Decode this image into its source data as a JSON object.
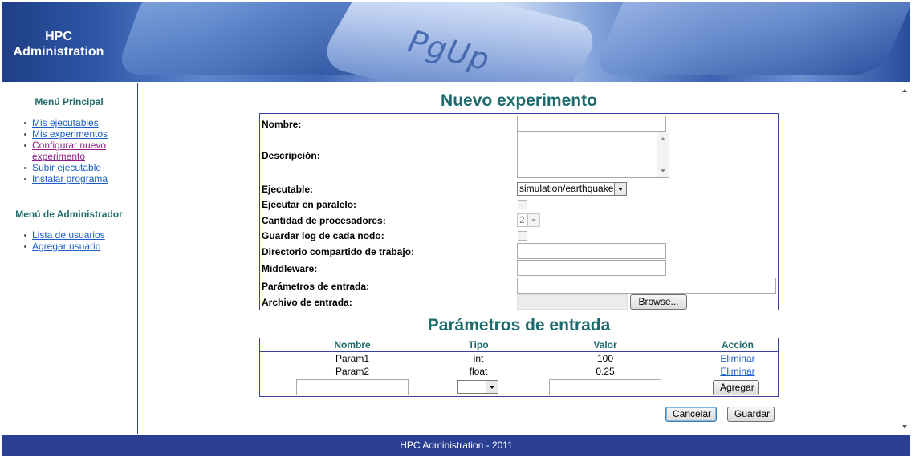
{
  "header": {
    "logo_line1": "HPC",
    "logo_line2": "Administration",
    "banner_key_text": "PgUp"
  },
  "sidebar": {
    "main_menu_title": "Menú Principal",
    "main_menu_items": [
      {
        "label": "Mis ejecutables"
      },
      {
        "label": "Mis experimentos"
      },
      {
        "label": "Configurar nuevo experimento"
      },
      {
        "label": "Subir ejecutable"
      },
      {
        "label": "Instalar programa"
      }
    ],
    "admin_menu_title": "Menú de Administrador",
    "admin_menu_items": [
      {
        "label": "Lista de usuarios"
      },
      {
        "label": "Agregar usuario"
      }
    ]
  },
  "form": {
    "title": "Nuevo experimento",
    "nombre_label": "Nombre:",
    "nombre_value": "",
    "descripcion_label": "Descripción:",
    "descripcion_value": "",
    "ejecutable_label": "Ejecutable:",
    "ejecutable_value": "simulation/earthquake",
    "paralelo_label": "Ejecutar en paralelo:",
    "paralelo_checked": false,
    "procesadores_label": "Cantidad de procesadores:",
    "procesadores_value": "2",
    "log_label": "Guardar log de cada nodo:",
    "log_checked": false,
    "directorio_label": "Directorio compartido de trabajo:",
    "directorio_value": "",
    "middleware_label": "Middleware:",
    "middleware_value": "",
    "parametros_label": "Parámetros de entrada:",
    "parametros_value": "",
    "archivo_label": "Archivo de entrada:",
    "browse_label": "Browse..."
  },
  "params": {
    "title": "Parámetros de entrada",
    "headers": {
      "nombre": "Nombre",
      "tipo": "Tipo",
      "valor": "Valor",
      "accion": "Acción"
    },
    "rows": [
      {
        "nombre": "Param1",
        "tipo": "int",
        "valor": "100",
        "accion": "Eliminar"
      },
      {
        "nombre": "Param2",
        "tipo": "float",
        "valor": "0.25",
        "accion": "Eliminar"
      }
    ],
    "new_nombre": "",
    "new_tipo": "",
    "new_valor": "",
    "add_label": "Agregar"
  },
  "actions": {
    "cancel_label": "Cancelar",
    "save_label": "Guardar"
  },
  "footer": {
    "text": "HPC Administration - 2011"
  }
}
